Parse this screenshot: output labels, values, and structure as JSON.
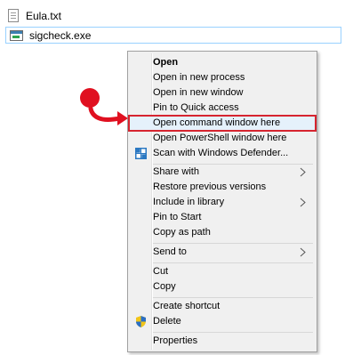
{
  "files": [
    {
      "name": "Eula.txt",
      "icon": "txt-file-icon"
    },
    {
      "name": "sigcheck.exe",
      "icon": "exe-file-icon",
      "selected": true
    }
  ],
  "menu": {
    "groups": [
      [
        {
          "label": "Open",
          "bold": true
        },
        {
          "label": "Open in new process"
        },
        {
          "label": "Open in new window"
        },
        {
          "label": "Pin to Quick access"
        },
        {
          "label": "Open command window here",
          "highlighted": true
        },
        {
          "label": "Open PowerShell window here"
        },
        {
          "label": "Scan with Windows Defender...",
          "icon": "windows-defender-icon"
        }
      ],
      [
        {
          "label": "Share with",
          "submenu": true
        },
        {
          "label": "Restore previous versions"
        },
        {
          "label": "Include in library",
          "submenu": true
        },
        {
          "label": "Pin to Start"
        },
        {
          "label": "Copy as path"
        }
      ],
      [
        {
          "label": "Send to",
          "submenu": true
        }
      ],
      [
        {
          "label": "Cut"
        },
        {
          "label": "Copy"
        }
      ],
      [
        {
          "label": "Create shortcut"
        },
        {
          "label": "Delete",
          "icon": "uac-shield-icon"
        }
      ],
      [
        {
          "label": "Properties"
        }
      ]
    ]
  },
  "colors": {
    "highlight_border": "#d6242f",
    "annotation_arrow": "#e01020",
    "selection_border": "#99d1ff",
    "menu_background": "#f0f0f0"
  }
}
